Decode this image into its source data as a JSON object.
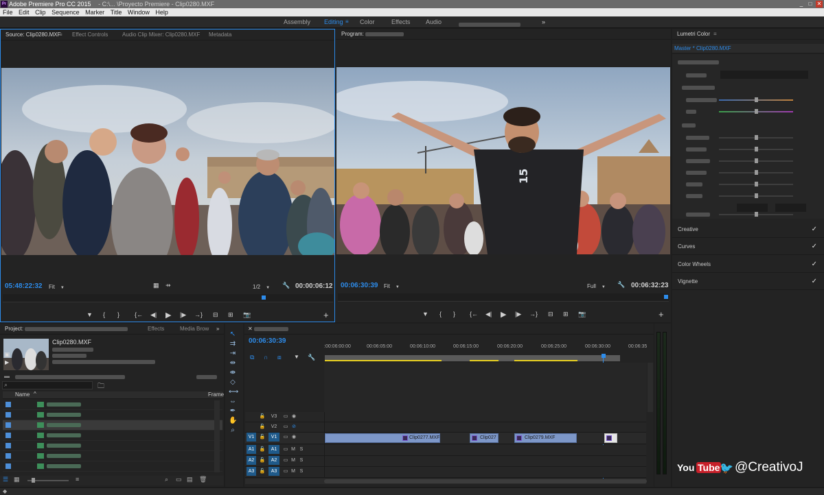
{
  "app": {
    "title": "Adobe Premiere Pro CC 2015",
    "title_rest": "- C:\\... \\Proyecto Premiere - Clip0280.MXF",
    "icon": "Pr"
  },
  "menu": [
    "File",
    "Edit",
    "Clip",
    "Sequence",
    "Marker",
    "Title",
    "Window",
    "Help"
  ],
  "workspaces": {
    "items": [
      "Assembly",
      "Editing",
      "Color",
      "Effects",
      "Audio"
    ],
    "active": "Editing",
    "overflow": "»"
  },
  "source": {
    "tabs": [
      "Source: Clip0280.MXF",
      "Effect Controls",
      "Audio Clip Mixer: Clip0280.MXF",
      "Metadata"
    ],
    "timecode": "05:48:22:32",
    "fit": "Fit",
    "resolution": "1/2",
    "duration": "00:00:06:12"
  },
  "program": {
    "tab_prefix": "Program:",
    "timecode": "00:06:30:39",
    "fit": "Fit",
    "resolution": "Full",
    "duration": "00:06:32:23"
  },
  "transport": {
    "marker": "▼",
    "in": "{",
    "out": "}",
    "goto_in": "{←",
    "step_back": "◀|",
    "play": "▶",
    "step_fwd": "|▶",
    "goto_out": "→}",
    "insert": "⊟",
    "overwrite": "⊞",
    "export": "📷",
    "add": "+"
  },
  "lumetri": {
    "title": "Lumetri Color",
    "master": "Master * Clip0280.MXF",
    "sections": [
      "Creative",
      "Curves",
      "Color Wheels",
      "Vignette"
    ],
    "check": "✓"
  },
  "project": {
    "tabs": [
      "Project:",
      "Effects",
      "Media Brow"
    ],
    "clip_name": "Clip0280.MXF",
    "column_name": "Name",
    "column_frame": "Frame"
  },
  "timeline": {
    "timecode": "00:06:30:39",
    "ticks": [
      ":00:06:00:00",
      "00:06:05:00",
      "00:06:10:00",
      "00:06:15:00",
      "00:06:20:00",
      "00:06:25:00",
      "00:06:30:00",
      "00:06:35"
    ],
    "video_tracks": [
      "V3",
      "V2",
      "V1"
    ],
    "audio_tracks": [
      "A1",
      "A2",
      "A3"
    ],
    "clips": [
      {
        "name": "Clip0277.MXF"
      },
      {
        "name": "Clip027"
      },
      {
        "name": "Clip0279.MXF"
      }
    ],
    "mute": "M",
    "solo": "S"
  },
  "watermark": {
    "youtube_you": "You",
    "youtube_tube": "Tube",
    "handle": "@CreativoJ"
  },
  "colors": {
    "accent": "#2d8ceb",
    "panel": "#232323",
    "clip": "#7d97c8",
    "track_target": "#1f5a8a"
  }
}
